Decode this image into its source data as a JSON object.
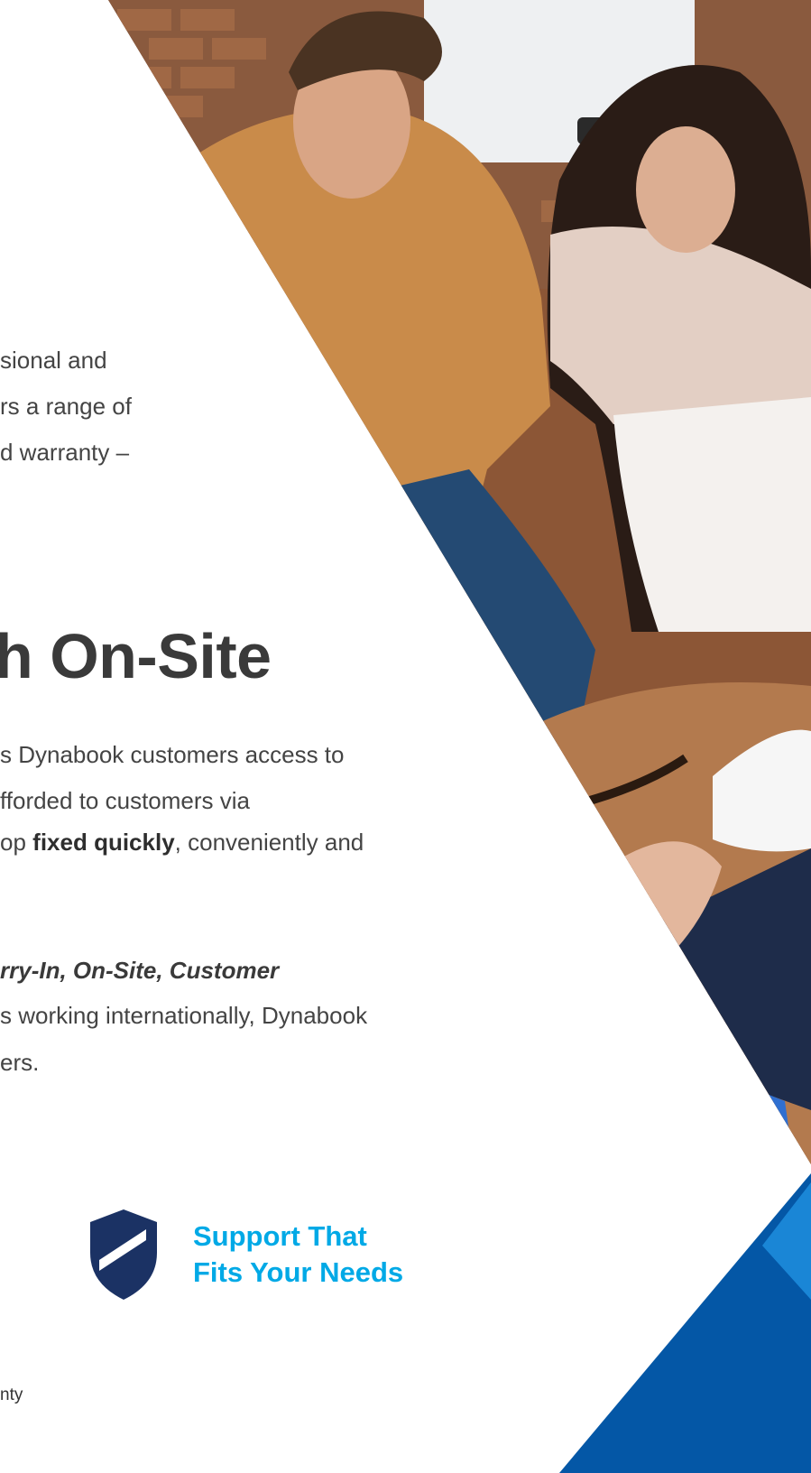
{
  "intro": {
    "line1": "sional and",
    "line2": "rs a range of",
    "line3": "d warranty –"
  },
  "heading": {
    "text": "h On-Site"
  },
  "paragraph": {
    "line1": "s Dynabook customers access to",
    "line2": "fforded to customers via",
    "line3_prefix": "op ",
    "line3_bold": "fixed quickly",
    "line3_suffix": ", conveniently and"
  },
  "services": {
    "italic_line": "rry-In, On-Site, Customer",
    "line2": "s working internationally, Dynabook",
    "line3": "ers."
  },
  "badge": {
    "line1": "Support That",
    "line2": "Fits Your Needs",
    "icon": "shield-check-icon"
  },
  "footnote": {
    "text": "nty"
  },
  "colors": {
    "accent": "#00a9e6",
    "navy": "#1b3264",
    "blue_dark": "#0457a6",
    "blue_light": "#1a86d6"
  }
}
